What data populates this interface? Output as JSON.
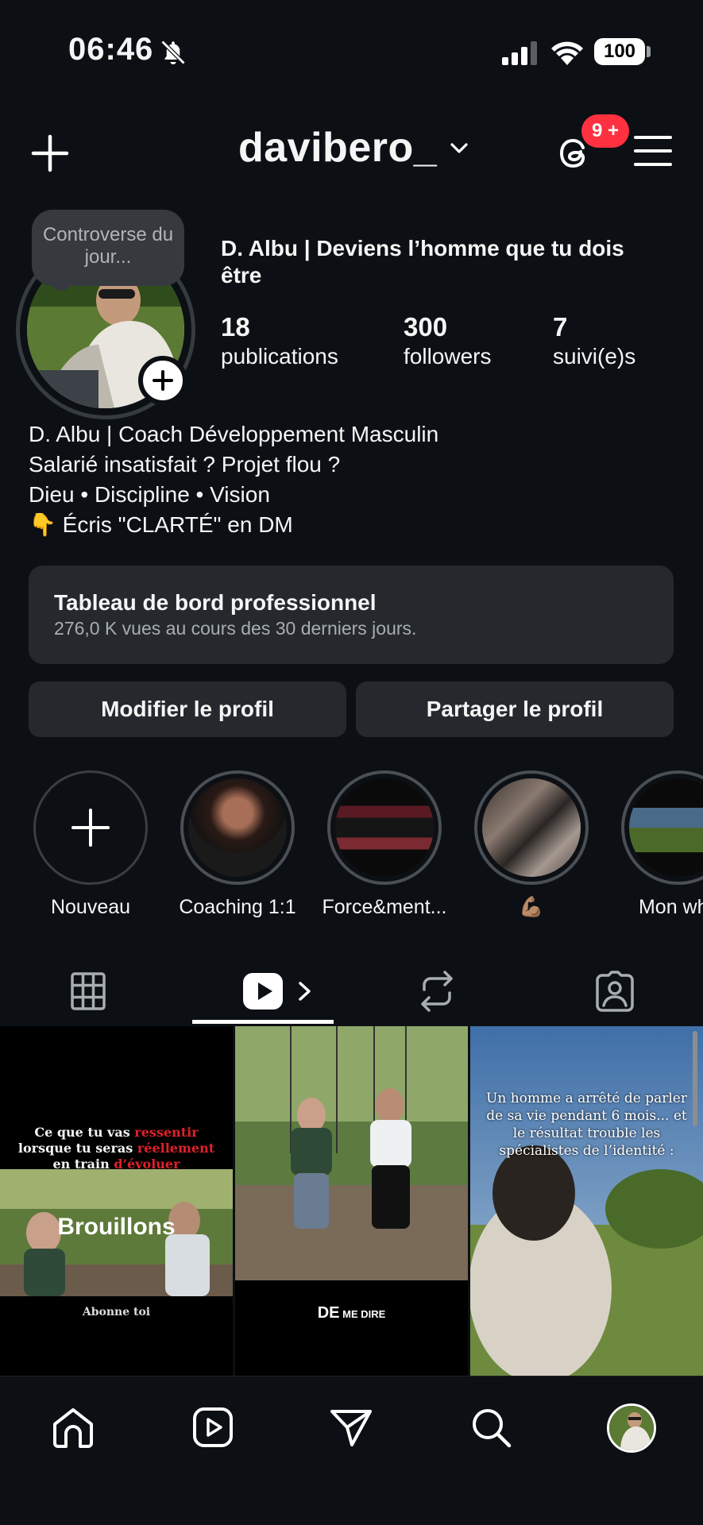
{
  "status_bar": {
    "time": "06:46",
    "battery": "100"
  },
  "header": {
    "username": "davibero_",
    "notifications_badge": "9 +"
  },
  "profile": {
    "note": "Controverse du jour...",
    "display_name": "D. Albu | Deviens l’homme que tu dois être",
    "stats": [
      {
        "value": "18",
        "label": "publications"
      },
      {
        "value": "300",
        "label": "followers"
      },
      {
        "value": "7",
        "label": "suivi(e)s"
      }
    ],
    "bio": [
      "D. Albu | Coach Développement Masculin",
      "Salarié insatisfait ? Projet flou ?",
      "Dieu • Discipline • Vision",
      "👇 Écris \"CLARTÉ\" en DM"
    ]
  },
  "dashboard": {
    "title": "Tableau de bord professionnel",
    "subtitle": "276,0 K vues au cours des 30 derniers jours."
  },
  "actions": {
    "edit": "Modifier le profil",
    "share": "Partager le profil"
  },
  "highlights": [
    {
      "label": "Nouveau"
    },
    {
      "label": "Coaching 1:1"
    },
    {
      "label": "Force&ment..."
    },
    {
      "label": "💪🏽"
    },
    {
      "label": "Mon why"
    }
  ],
  "grid": {
    "drafts_label": "Brouillons",
    "cell1_caption_a": "Ce que tu vas ",
    "cell1_caption_b": "ressentir",
    "cell1_caption_c": " lorsque tu seras ",
    "cell1_caption_d": "réellement",
    "cell1_caption_e": " en train ",
    "cell1_caption_f": "d’évoluer",
    "cell1_footer": "Abonne toi",
    "cell2_caption_big": "DE",
    "cell2_caption_small": " ME DIRE",
    "cell3_caption": "Un homme a arrêté de parler de sa vie pendant 6 mois... et le résultat trouble les spécialistes de l’identité :"
  },
  "colors": {
    "background": "#0c1014",
    "card": "#25292e",
    "badge": "#ff3040",
    "accent_red": "#e0202a"
  }
}
